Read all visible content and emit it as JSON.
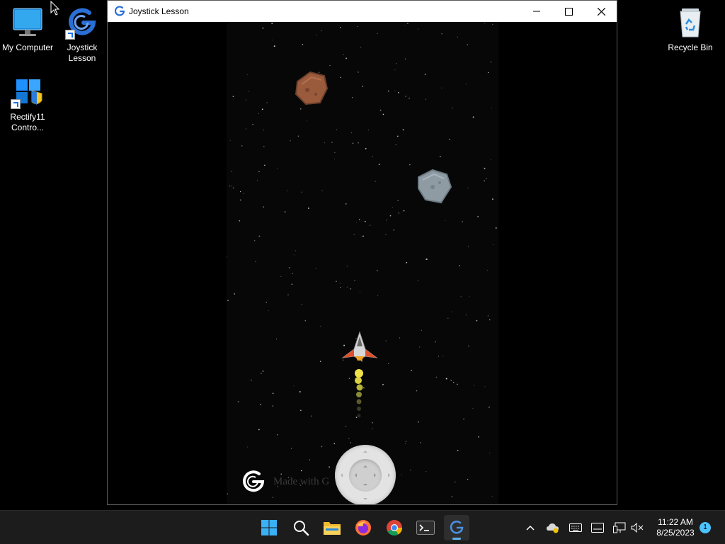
{
  "desktop": {
    "icons": [
      {
        "label": "My Computer",
        "icon": "monitor-icon"
      },
      {
        "label": "Joystick Lesson",
        "icon": "gdevelop-icon"
      },
      {
        "label": "Rectify11 Contro...",
        "icon": "control-panel-icon"
      },
      {
        "label": "Recycle Bin",
        "icon": "recycle-bin-icon"
      }
    ]
  },
  "window": {
    "title": "Joystick Lesson",
    "icon": "gdevelop-icon",
    "controls": {
      "minimize": "minimize-icon",
      "maximize": "maximize-icon",
      "close": "close-icon"
    }
  },
  "game": {
    "background_color": "#070707",
    "entities": [
      "asteroid-brown",
      "asteroid-grey",
      "spaceship",
      "joystick"
    ],
    "watermark_text": "Made with G"
  },
  "taskbar": {
    "apps": [
      {
        "name": "Start",
        "icon": "windows-start-icon"
      },
      {
        "name": "Search",
        "icon": "search-icon"
      },
      {
        "name": "File Explorer",
        "icon": "folder-icon"
      },
      {
        "name": "Firefox",
        "icon": "firefox-icon"
      },
      {
        "name": "Chrome",
        "icon": "chrome-icon"
      },
      {
        "name": "Terminal",
        "icon": "terminal-icon"
      },
      {
        "name": "GDevelop",
        "icon": "gdevelop-icon",
        "active": true
      }
    ],
    "tray": {
      "icons": [
        "chevron-up-icon",
        "onedrive-icon",
        "keyboard-icon",
        "touch-keyboard-icon",
        "network-icon",
        "volume-muted-icon"
      ],
      "time": "11:22 AM",
      "date": "8/25/2023",
      "notifications": "1"
    }
  }
}
